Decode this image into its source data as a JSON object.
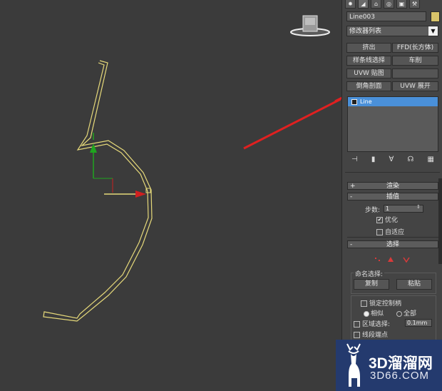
{
  "panel": {
    "object_name": "Line003",
    "modifier_list": "修改器列表",
    "modifier_buttons": [
      "挤出",
      "FFD(长方体)",
      "样条线选择",
      "车削",
      "UVW 贴图",
      "",
      "倒角剖面",
      "UVW 展开"
    ],
    "stack_item": "Line",
    "rollouts": {
      "render": "渲染",
      "interpolation": "插值",
      "selection": "选择"
    },
    "interpolation": {
      "steps_label": "步数:",
      "steps_value": "1",
      "optimize": "优化",
      "adaptive": "自适应"
    },
    "selection": {
      "named_sel_label": "命名选择:",
      "copy": "复制",
      "paste": "粘贴",
      "lock_handles": "锁定控制柄",
      "similar": "相似",
      "all": "全部",
      "area_select": "区域选择:",
      "area_value": "0.1mm",
      "segment_end": "线段端点"
    }
  },
  "watermark": {
    "brand": "3D溜溜网",
    "url": "3D66.COM"
  },
  "colors": {
    "viewport_bg": "#3b3b3b",
    "spline": "#e6d97a",
    "annotation": "#e02020",
    "selected_stack": "#4a90d9"
  }
}
